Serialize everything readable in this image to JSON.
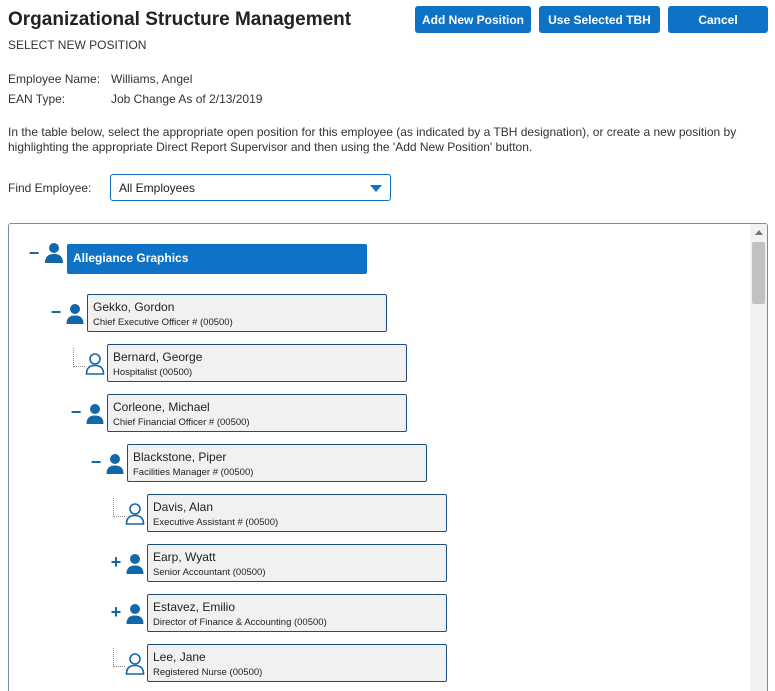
{
  "header": {
    "title": "Organizational Structure Management",
    "subtitle": "SELECT NEW POSITION"
  },
  "buttons": {
    "add_new_position": "Add New Position",
    "use_selected_tbh": "Use Selected TBH",
    "cancel": "Cancel"
  },
  "employee_info": {
    "name_label": "Employee Name:",
    "name_value": "Williams, Angel",
    "ean_label": "EAN Type:",
    "ean_value": "Job Change As of 2/13/2019"
  },
  "instructions": "In the table below, select the appropriate open position for this employee (as indicated by a TBH designation), or create a new position by highlighting the appropriate Direct Report Supervisor and then using the 'Add New Position' button.",
  "find": {
    "label": "Find Employee:",
    "selected": "All Employees"
  },
  "tree": {
    "root": {
      "name": "Allegiance Graphics",
      "toggle": "−"
    },
    "nodes": [
      {
        "name": "Gekko, Gordon",
        "title": "Chief Executive Officer # (00500)",
        "toggle": "−",
        "icon": "person-filled-icon"
      },
      {
        "name": "Bernard, George",
        "title": "Hospitalist (00500)",
        "toggle": "",
        "icon": "person-outline-icon"
      },
      {
        "name": "Corleone, Michael",
        "title": "Chief Financial Officer # (00500)",
        "toggle": "−",
        "icon": "person-filled-icon"
      },
      {
        "name": "Blackstone, Piper",
        "title": "Facilities Manager # (00500)",
        "toggle": "−",
        "icon": "person-filled-icon"
      },
      {
        "name": "Davis, Alan",
        "title": "Executive Assistant # (00500)",
        "toggle": "",
        "icon": "person-outline-icon"
      },
      {
        "name": "Earp, Wyatt",
        "title": "Senior Accountant (00500)",
        "toggle": "+",
        "icon": "person-filled-icon"
      },
      {
        "name": "Estavez, Emilio",
        "title": "Director of Finance & Accounting (00500)",
        "toggle": "+",
        "icon": "person-filled-icon"
      },
      {
        "name": "Lee, Jane",
        "title": "Registered Nurse (00500)",
        "toggle": "",
        "icon": "person-outline-icon"
      }
    ]
  },
  "colors": {
    "accent": "#0e73c6",
    "icon": "#1267a8",
    "card_bg": "#f1f1f1"
  }
}
